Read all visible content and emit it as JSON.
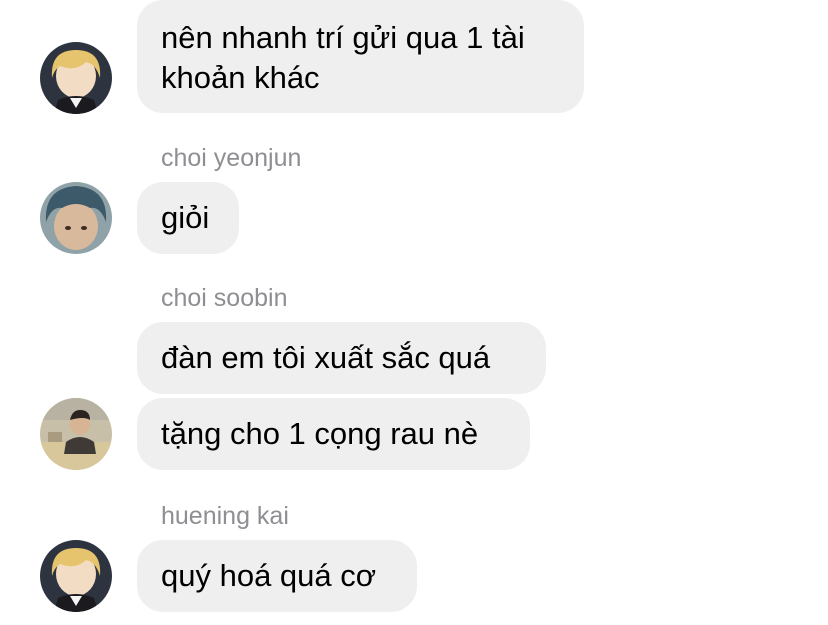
{
  "messages": [
    {
      "text": "nên nhanh trí gửi qua 1 tài khoản khác"
    },
    {
      "sender": "choi yeonjun",
      "text": "giỏi"
    },
    {
      "sender": "choi soobin",
      "texts": [
        "đàn em tôi xuất sắc quá",
        "tặng cho 1 cọng rau nè"
      ]
    },
    {
      "sender": "huening kai",
      "text": "quý hoá quá cơ"
    }
  ],
  "avatars": {
    "user1": "avatar-blonde",
    "yeonjun": "avatar-blue-hair",
    "soobin": "avatar-photo",
    "kai": "avatar-blonde"
  },
  "colors": {
    "bubble": "#efefef",
    "sender": "#8e8e93",
    "text": "#000000",
    "background": "#ffffff"
  }
}
